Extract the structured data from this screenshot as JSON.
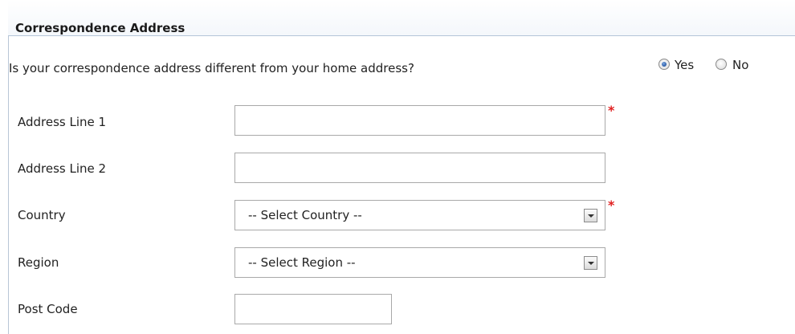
{
  "section": {
    "title": "Correspondence Address",
    "question": "Is your correspondence address different from your home address?",
    "radio": {
      "options": [
        "Yes",
        "No"
      ],
      "selected": "Yes"
    }
  },
  "fields": {
    "address_line_1": {
      "label": "Address Line 1",
      "value": "",
      "required": "*"
    },
    "address_line_2": {
      "label": "Address Line 2",
      "value": ""
    },
    "country": {
      "label": "Country",
      "selected": "-- Select Country --",
      "required": "*"
    },
    "region": {
      "label": "Region",
      "selected": "-- Select Region --"
    },
    "post_code": {
      "label": "Post Code",
      "value": ""
    }
  },
  "colors": {
    "required_marker": "#e02020",
    "radio_checked": "#1f4f9c",
    "header_rule": "#b3c4d8"
  },
  "icons": [
    "radio-checked-icon",
    "radio-unchecked-icon",
    "dropdown-arrow-icon"
  ]
}
